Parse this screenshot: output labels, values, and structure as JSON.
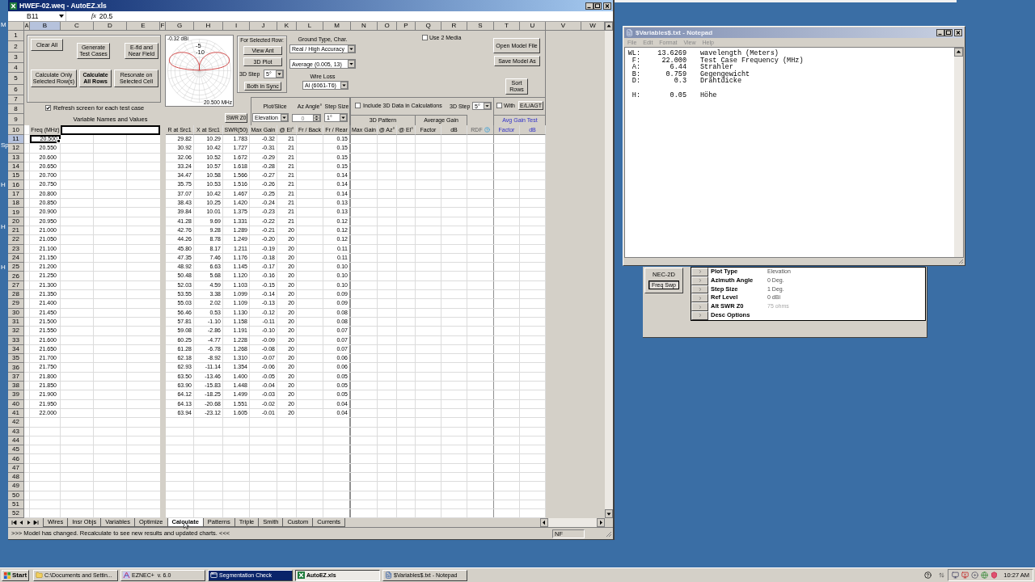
{
  "desktop": {
    "icon_label_fragments": [
      "M",
      "Sp",
      "H",
      "H",
      "H"
    ]
  },
  "excel": {
    "title": "HWEF-02.weq - AutoEZ.xls",
    "name_box": "B11",
    "fx": "fx",
    "formula": "20.5",
    "columns": [
      {
        "label": "A",
        "selected": false
      },
      {
        "label": "B",
        "selected": true
      },
      {
        "label": "C",
        "selected": false
      },
      {
        "label": "D",
        "selected": false
      },
      {
        "label": "E",
        "selected": false
      },
      {
        "label": "F",
        "selected": false
      },
      {
        "label": "G",
        "selected": false
      },
      {
        "label": "H",
        "selected": false
      },
      {
        "label": "I",
        "selected": false
      },
      {
        "label": "J",
        "selected": false
      },
      {
        "label": "K",
        "selected": false
      },
      {
        "label": "L",
        "selected": false
      },
      {
        "label": "M",
        "selected": false
      },
      {
        "label": "N",
        "selected": false
      },
      {
        "label": "O",
        "selected": false
      },
      {
        "label": "P",
        "selected": false
      },
      {
        "label": "Q",
        "selected": false
      },
      {
        "label": "R",
        "selected": false
      },
      {
        "label": "S",
        "selected": false
      },
      {
        "label": "T",
        "selected": false
      },
      {
        "label": "U",
        "selected": false
      },
      {
        "label": "V",
        "selected": false
      },
      {
        "label": "W",
        "selected": false
      }
    ],
    "row_numbers": [
      {
        "label": "1",
        "selected": false
      },
      {
        "label": "2",
        "selected": false
      },
      {
        "label": "3",
        "selected": false
      },
      {
        "label": "4",
        "selected": false
      },
      {
        "label": "5",
        "selected": false
      },
      {
        "label": "6",
        "selected": false
      },
      {
        "label": "7",
        "selected": false
      },
      {
        "label": "8",
        "selected": false
      },
      {
        "label": "9",
        "selected": false
      },
      {
        "label": "10",
        "selected": false
      },
      {
        "label": "11",
        "selected": true
      },
      {
        "label": "12",
        "selected": false
      },
      {
        "label": "13",
        "selected": false
      },
      {
        "label": "14",
        "selected": false
      },
      {
        "label": "15",
        "selected": false
      },
      {
        "label": "16",
        "selected": false
      },
      {
        "label": "17",
        "selected": false
      },
      {
        "label": "18",
        "selected": false
      },
      {
        "label": "19",
        "selected": false
      },
      {
        "label": "20",
        "selected": false
      },
      {
        "label": "21",
        "selected": false
      },
      {
        "label": "22",
        "selected": false
      },
      {
        "label": "23",
        "selected": false
      },
      {
        "label": "24",
        "selected": false
      },
      {
        "label": "25",
        "selected": false
      },
      {
        "label": "26",
        "selected": false
      },
      {
        "label": "27",
        "selected": false
      },
      {
        "label": "28",
        "selected": false
      },
      {
        "label": "29",
        "selected": false
      },
      {
        "label": "30",
        "selected": false
      },
      {
        "label": "31",
        "selected": false
      },
      {
        "label": "32",
        "selected": false
      },
      {
        "label": "33",
        "selected": false
      },
      {
        "label": "34",
        "selected": false
      },
      {
        "label": "35",
        "selected": false
      },
      {
        "label": "36",
        "selected": false
      },
      {
        "label": "37",
        "selected": false
      },
      {
        "label": "38",
        "selected": false
      },
      {
        "label": "39",
        "selected": false
      },
      {
        "label": "40",
        "selected": false
      },
      {
        "label": "41",
        "selected": false
      },
      {
        "label": "42",
        "selected": false
      },
      {
        "label": "43",
        "selected": false
      },
      {
        "label": "44",
        "selected": false
      },
      {
        "label": "45",
        "selected": false
      },
      {
        "label": "46",
        "selected": false
      },
      {
        "label": "47",
        "selected": false
      },
      {
        "label": "48",
        "selected": false
      },
      {
        "label": "49",
        "selected": false
      },
      {
        "label": "50",
        "selected": false
      },
      {
        "label": "51",
        "selected": false
      },
      {
        "label": "52",
        "selected": false
      }
    ],
    "calc_panel": {
      "clear_all": "Clear All",
      "generate": "Generate Test Cases",
      "efield": "E-fld and Near Field",
      "calc_selected": "Calculate Only Selected Row(s)",
      "calc_all": "Calculate All Rows",
      "resonate": "Resonate on Selected Cell"
    },
    "refresh": {
      "label": "Refresh screen for each test case",
      "checked": true
    },
    "variables_heading": "Variable Names and Values",
    "pattern_plot": {
      "peak_label": "-0.32 dBi",
      "frequency_label": "20.500 MHz",
      "ring_labels": [
        "-5",
        "-10"
      ]
    },
    "selected_row": {
      "heading": "For Selected Row:",
      "view_ant": "View Ant",
      "plot_3d": "3D Plot",
      "step_label": "3D Step",
      "step_value": "5°",
      "sync": "Both in Sync"
    },
    "ground": {
      "heading": "Ground Type, Char.",
      "ground_type": "Real / High Accuracy",
      "ground_char": "Average (0.005, 13)",
      "wire_loss_label": "Wire Loss",
      "wire_loss": "Al (6061-T6)"
    },
    "use_2_media": {
      "label": "Use 2 Media",
      "checked": false
    },
    "file_buttons": {
      "open": "Open Model File",
      "save": "Save Model As",
      "sort": "Sort Rows"
    },
    "plot_controls": {
      "swr_z0": "SWR Z0",
      "plot_slice_label": "Plot/Slice",
      "plot_slice": "Elevation",
      "az_label": "Az Angle°",
      "az_value": "0",
      "step_label": "Step Size",
      "step_value": "1°"
    },
    "include_3d": {
      "label": "Include 3D Data in Calculations",
      "checked": false
    },
    "step_3d": {
      "label": "3D Step",
      "value": "5°"
    },
    "with_agt": {
      "label": "With",
      "checked": false,
      "button": "E/L/AGT"
    },
    "group_headings": {
      "pattern_3d": "3D Pattern",
      "average_gain": "Average Gain",
      "avg_gain_test": "Avg Gain Test"
    },
    "freq_heading": "Freq (MHz)",
    "table_columns": [
      "R at Src1",
      "X at Src1",
      "SWR(50)",
      "Max Gain",
      "@ El°",
      "Fr / Back",
      "Fr / Rear",
      "Max Gain",
      "@ Az°",
      "@ El°",
      "Factor",
      "dB",
      "RDF"
    ],
    "test_columns": [
      "Factor",
      "dB"
    ],
    "records": [
      [
        "20.500",
        "29.82",
        "10.29",
        "1.783",
        "-0.32",
        "21",
        "0.15"
      ],
      [
        "20.550",
        "30.92",
        "10.42",
        "1.727",
        "-0.31",
        "21",
        "0.15"
      ],
      [
        "20.600",
        "32.06",
        "10.52",
        "1.672",
        "-0.29",
        "21",
        "0.15"
      ],
      [
        "20.650",
        "33.24",
        "10.57",
        "1.618",
        "-0.28",
        "21",
        "0.15"
      ],
      [
        "20.700",
        "34.47",
        "10.58",
        "1.566",
        "-0.27",
        "21",
        "0.14"
      ],
      [
        "20.750",
        "35.75",
        "10.53",
        "1.516",
        "-0.26",
        "21",
        "0.14"
      ],
      [
        "20.800",
        "37.07",
        "10.42",
        "1.467",
        "-0.25",
        "21",
        "0.14"
      ],
      [
        "20.850",
        "38.43",
        "10.25",
        "1.420",
        "-0.24",
        "21",
        "0.13"
      ],
      [
        "20.900",
        "39.84",
        "10.01",
        "1.375",
        "-0.23",
        "21",
        "0.13"
      ],
      [
        "20.950",
        "41.28",
        "9.69",
        "1.331",
        "-0.22",
        "21",
        "0.12"
      ],
      [
        "21.000",
        "42.76",
        "9.28",
        "1.289",
        "-0.21",
        "20",
        "0.12"
      ],
      [
        "21.050",
        "44.26",
        "8.78",
        "1.249",
        "-0.20",
        "20",
        "0.12"
      ],
      [
        "21.100",
        "45.80",
        "8.17",
        "1.211",
        "-0.19",
        "20",
        "0.11"
      ],
      [
        "21.150",
        "47.35",
        "7.46",
        "1.176",
        "-0.18",
        "20",
        "0.11"
      ],
      [
        "21.200",
        "48.92",
        "6.63",
        "1.145",
        "-0.17",
        "20",
        "0.10"
      ],
      [
        "21.250",
        "50.48",
        "5.68",
        "1.120",
        "-0.16",
        "20",
        "0.10"
      ],
      [
        "21.300",
        "52.03",
        "4.59",
        "1.103",
        "-0.15",
        "20",
        "0.10"
      ],
      [
        "21.350",
        "53.55",
        "3.38",
        "1.099",
        "-0.14",
        "20",
        "0.09"
      ],
      [
        "21.400",
        "55.03",
        "2.02",
        "1.109",
        "-0.13",
        "20",
        "0.09"
      ],
      [
        "21.450",
        "56.46",
        "0.53",
        "1.130",
        "-0.12",
        "20",
        "0.08"
      ],
      [
        "21.500",
        "57.81",
        "-1.10",
        "1.158",
        "-0.11",
        "20",
        "0.08"
      ],
      [
        "21.550",
        "59.08",
        "-2.86",
        "1.191",
        "-0.10",
        "20",
        "0.07"
      ],
      [
        "21.600",
        "60.25",
        "-4.77",
        "1.228",
        "-0.09",
        "20",
        "0.07"
      ],
      [
        "21.650",
        "61.28",
        "-6.78",
        "1.268",
        "-0.08",
        "20",
        "0.07"
      ],
      [
        "21.700",
        "62.18",
        "-8.92",
        "1.310",
        "-0.07",
        "20",
        "0.06"
      ],
      [
        "21.750",
        "62.93",
        "-11.14",
        "1.354",
        "-0.06",
        "20",
        "0.06"
      ],
      [
        "21.800",
        "63.50",
        "-13.46",
        "1.400",
        "-0.05",
        "20",
        "0.05"
      ],
      [
        "21.850",
        "63.90",
        "-15.83",
        "1.448",
        "-0.04",
        "20",
        "0.05"
      ],
      [
        "21.900",
        "64.12",
        "-18.25",
        "1.499",
        "-0.03",
        "20",
        "0.05"
      ],
      [
        "21.950",
        "64.13",
        "-20.68",
        "1.551",
        "-0.02",
        "20",
        "0.04"
      ],
      [
        "22.000",
        "63.94",
        "-23.12",
        "1.605",
        "-0.01",
        "20",
        "0.04"
      ]
    ],
    "sheet_tabs": [
      {
        "label": "Wires",
        "selected": false
      },
      {
        "label": "Insr Objs",
        "selected": false
      },
      {
        "label": "Variables",
        "selected": false
      },
      {
        "label": "Optimize",
        "selected": false
      },
      {
        "label": "Calculate",
        "selected": true
      },
      {
        "label": "Patterns",
        "selected": false
      },
      {
        "label": "Triple",
        "selected": false
      },
      {
        "label": "Smith",
        "selected": false
      },
      {
        "label": "Custom",
        "selected": false
      },
      {
        "label": "Currents",
        "selected": false
      }
    ],
    "status": ">>> Model has changed. Recalculate to see new results and updated charts. <<<",
    "status_indicator": "NF"
  },
  "notepad": {
    "title": "$Variables$.txt - Notepad",
    "menu": [
      "File",
      "Edit",
      "Format",
      "View",
      "Help"
    ],
    "blocks": [
      [
        {
          "name": "WL:",
          "value": "13.6269",
          "description": "wavelength (Meters)"
        },
        {
          "name": "F:",
          "value": "22.000",
          "description": "Test Case Frequency (MHz)"
        },
        {
          "name": "A:",
          "value": "6.44",
          "description": "Strahler"
        },
        {
          "name": "B:",
          "value": "0.759",
          "description": "Gegengewicht"
        },
        {
          "name": "D:",
          "value": "0.3",
          "description": "Drahtdicke"
        }
      ],
      [
        {
          "name": "H:",
          "value": "0.05",
          "description": "Höhe"
        }
      ]
    ]
  },
  "eznec_panel": {
    "engine": "NEC-2D",
    "freq_sweep": {
      "label": "Freq Swp",
      "pressed": true
    },
    "settings": [
      {
        "label": "Plot Type",
        "value": "Elevation",
        "disabled": false
      },
      {
        "label": "Azimuth Angle",
        "value": "0 Deg.",
        "disabled": false
      },
      {
        "label": "Step Size",
        "value": "1 Deg.",
        "disabled": false
      },
      {
        "label": "Ref Level",
        "value": "0 dBi",
        "disabled": false
      },
      {
        "label": "Alt SWR Z0",
        "value": "75 ohms",
        "disabled": true
      },
      {
        "label": "Desc Options"
      }
    ]
  },
  "taskbar": {
    "start": "Start",
    "items": [
      {
        "label": "C:\\Documents and Settin...",
        "selected": false,
        "flashing": false
      },
      {
        "label": "EZNEC+  v. 6.0",
        "selected": false,
        "flashing": false
      },
      {
        "label": "Segmentation Check",
        "selected": false,
        "flashing": true
      },
      {
        "label": "AutoEZ.xls",
        "selected": true,
        "flashing": false
      },
      {
        "label": "$Variables$.txt - Notepad",
        "selected": false,
        "flashing": false
      }
    ],
    "clock": "10:27 AM"
  }
}
